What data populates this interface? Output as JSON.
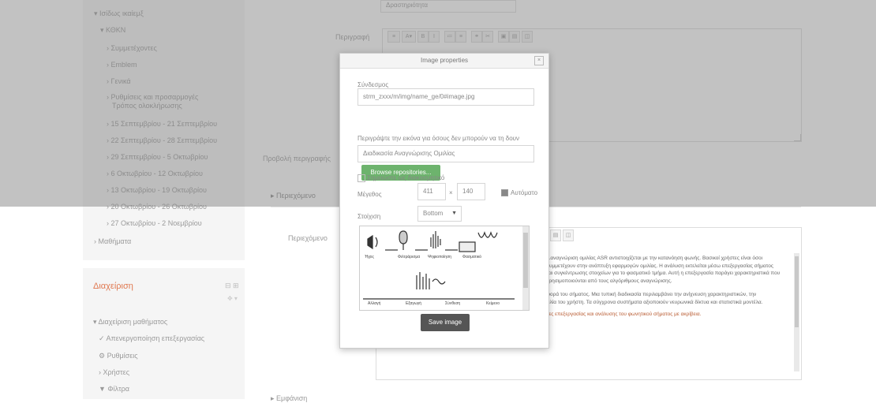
{
  "sidebar": {
    "items": [
      {
        "label": "▾ Ισίδως ικαίεμξ"
      },
      {
        "label": "▾ ΚΘΚΝ"
      },
      {
        "label": "› Συμμετέχοντες"
      },
      {
        "label": "› Emblem"
      },
      {
        "label": "› Γενικά"
      },
      {
        "label": "› Ρυθμίσεις και προσαρμογές"
      },
      {
        "label": "Τρόπος ολοκλήρωσης"
      },
      {
        "label": "› 15 Σεπτεμβρίου - 21 Σεπτεμβρίου"
      },
      {
        "label": "› 22 Σεπτεμβρίου - 28 Σεπτεμβρίου"
      },
      {
        "label": "› 29 Σεπτεμβρίου - 5 Οκτωβρίου"
      },
      {
        "label": "› 6 Οκτωβρίου - 12 Οκτωβρίου"
      },
      {
        "label": "› 13 Οκτωβρίου - 19 Οκτωβρίου"
      },
      {
        "label": "› 20 Οκτωβρίου - 26 Οκτωβρίου"
      },
      {
        "label": "› 27 Οκτωβρίου - 2 Νοεμβρίου"
      },
      {
        "label": "› Μαθήματα"
      }
    ]
  },
  "admin_block": {
    "title": "Διαχείριση",
    "items": [
      {
        "label": "▾ Διαχείριση μαθήματος"
      },
      {
        "label": "✓ Απενεργοποίηση επεξεργασίας"
      },
      {
        "label": "⚙ Ρυθμίσεις"
      },
      {
        "label": "› Χρήστες"
      },
      {
        "label": "▼ Φίλτρα"
      }
    ]
  },
  "form": {
    "name_value": "Δραστηριότητα",
    "description_label": "Περιγραφή",
    "display_label": "Προβολή περιγραφής",
    "section_heading": "▸ Περιεχόμενο",
    "content_label": "Περιεχόμενο",
    "footer_label": "▸ Εμφάνιση"
  },
  "modal": {
    "title": "Image properties",
    "url_label": "Σύνδεσμος",
    "url_value": "strm_zxxx/m/img/name_ge/0#image.jpg",
    "browse_button": "Browse repositories...",
    "alt_label": "Περιγράψτε την εικόνα για όσους δεν μπορούν να τη δουν",
    "alt_value": "Διαδικασία Αναγνώρισης Ομιλίας",
    "decorative_label": "Σημειώστε ως διακοσμητικό",
    "size_label": "Μέγεθος",
    "width_value": "411",
    "height_value": "140",
    "auto_size_label": "Αυτόματο",
    "align_label": "Στοίχιση",
    "align_value": "Bottom",
    "save_button": "Save image",
    "preview": {
      "stages": [
        "Ήχος",
        "Φιλτράρισμα",
        "Ψηφιοποίηση",
        "Φασματικό"
      ],
      "bottom_stages": [
        "Αλλαγή",
        "Εξαγωγή",
        "Σύνθεση",
        "Κείμενο"
      ]
    }
  },
  "editor_text": {
    "paragraph1": "...αναγνώριση ομιλίας ASR αντιστοιχίζεται με την κατανόηση φωνής. Βασικοί χρήστες είναι όσοι συμμετέχουν στην ανάπτυξη εφαρμογών ομιλίας. Η ανάλυση εκτελείται μέσω επεξεργασίας σήματος και συγκέντρωσης στοιχείων για το φασματικό τμήμα. Αυτή η επεξεργασία παράγει χαρακτηριστικά που χρησιμοποιούνται από τους αλγόριθμους αναγνώρισης.",
    "paragraph2": "Η αναγνώριση μπορεί να βασίζεται σε μοντέλα που δείχνουν την συμπεριφορά του σήματος. Μια τυπική διαδικασία περιλαμβάνει την ανίχνευση χαρακτηριστικών, την ταξινόμηση και τελικά την παραγωγή του κειμένου που αντιστοιχεί στην ομιλία του χρήστη. Τα σύγχρονα συστήματα αξιοποιούν νευρωνικά δίκτυα και στατιστικά μοντέλα.",
    "paragraph3": "Συμπεράσματα: ΑΡΤ εκπαιδευτική αξιοποίηση σε εφαρμογές με δυνατότητες επεξεργασίας και ανάλυσης του φωνητικού σήματος με ακρίβεια."
  }
}
